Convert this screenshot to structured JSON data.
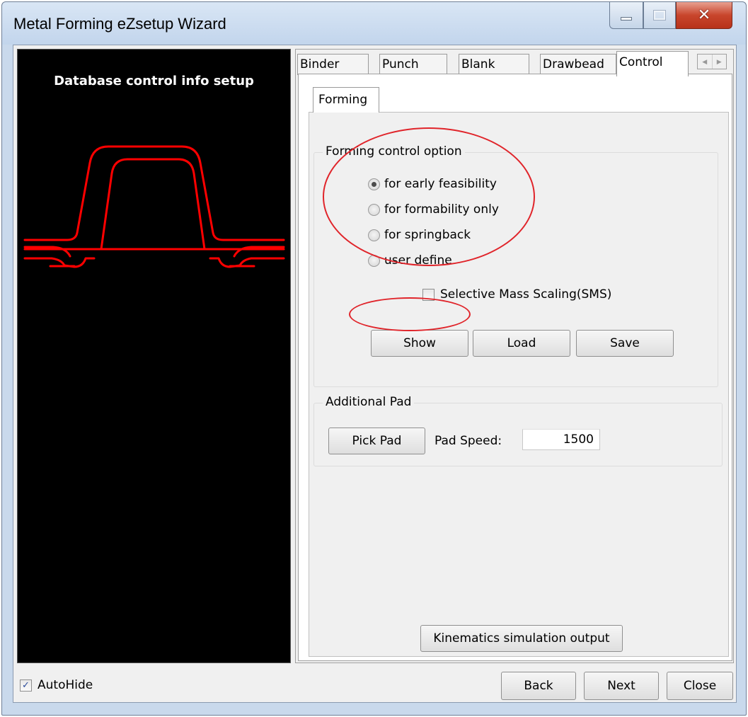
{
  "window": {
    "title": "Metal Forming eZsetup Wizard"
  },
  "preview": {
    "title": "Database control info setup",
    "line_color": "#ff0000"
  },
  "tabs": [
    {
      "label": "Binder"
    },
    {
      "label": "Punch"
    },
    {
      "label": "Blank"
    },
    {
      "label": "Drawbead"
    },
    {
      "label": "Control",
      "active": true
    }
  ],
  "subtab": {
    "label": "Forming"
  },
  "forming_control": {
    "group_label": "Forming control option",
    "options": [
      {
        "label": "for early feasibility",
        "checked": true
      },
      {
        "label": "for formability only",
        "checked": false
      },
      {
        "label": "for springback",
        "checked": false
      },
      {
        "label": "user define",
        "checked": false
      }
    ],
    "sms": {
      "label": "Selective Mass Scaling(SMS)",
      "checked": false
    },
    "buttons": {
      "show": "Show",
      "load": "Load",
      "save": "Save"
    }
  },
  "additional_pad": {
    "group_label": "Additional Pad",
    "pick_button": "Pick Pad",
    "speed_label": "Pad Speed:",
    "speed_value": "1500"
  },
  "kinematics_button": "Kinematics simulation output",
  "footer": {
    "autohide_label": "AutoHide",
    "autohide_checked": true,
    "back": "Back",
    "next": "Next",
    "close": "Close"
  },
  "annotation_color": "#e0242a"
}
